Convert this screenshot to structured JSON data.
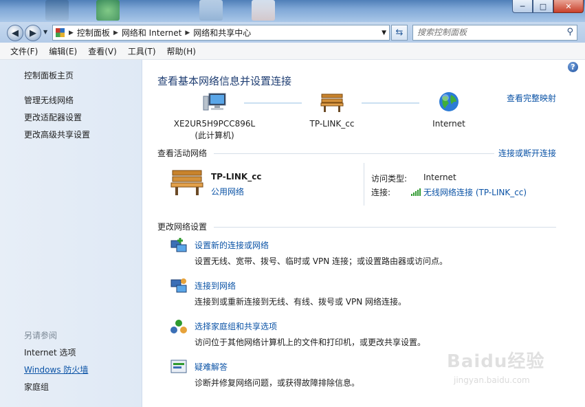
{
  "window": {
    "address_crumbs": [
      "控制面板",
      "网络和 Internet",
      "网络和共享中心"
    ],
    "search_placeholder": "搜索控制面板"
  },
  "menu": [
    "文件(F)",
    "编辑(E)",
    "查看(V)",
    "工具(T)",
    "帮助(H)"
  ],
  "sidebar": {
    "home": "控制面板主页",
    "links": [
      "管理无线网络",
      "更改适配器设置",
      "更改高级共享设置"
    ],
    "see_also_title": "另请参阅",
    "see_also": [
      "Internet 选项",
      "Windows 防火墙",
      "家庭组"
    ]
  },
  "main": {
    "title": "查看基本网络信息并设置连接",
    "full_map_link": "查看完整映射",
    "nodes": [
      {
        "label": "XE2UR5H9PCC896L",
        "sub": "(此计算机)"
      },
      {
        "label": "TP-LINK_cc",
        "sub": ""
      },
      {
        "label": "Internet",
        "sub": ""
      }
    ],
    "active_title": "查看活动网络",
    "connect_link": "连接或断开连接",
    "network_name": "TP-LINK_cc",
    "network_type": "公用网络",
    "access_type_label": "访问类型:",
    "access_type_value": "Internet",
    "connection_label": "连接:",
    "connection_value": "无线网络连接 (TP-LINK_cc)",
    "change_title": "更改网络设置",
    "tasks": [
      {
        "title": "设置新的连接或网络",
        "desc": "设置无线、宽带、拨号、临时或 VPN 连接；或设置路由器或访问点。"
      },
      {
        "title": "连接到网络",
        "desc": "连接到或重新连接到无线、有线、拨号或 VPN 网络连接。"
      },
      {
        "title": "选择家庭组和共享选项",
        "desc": "访问位于其他网络计算机上的文件和打印机，或更改共享设置。"
      },
      {
        "title": "疑难解答",
        "desc": "诊断并修复网络问题，或获得故障排除信息。"
      }
    ]
  },
  "watermark": {
    "text": "Baidu经验",
    "url": "jingyan.baidu.com"
  }
}
